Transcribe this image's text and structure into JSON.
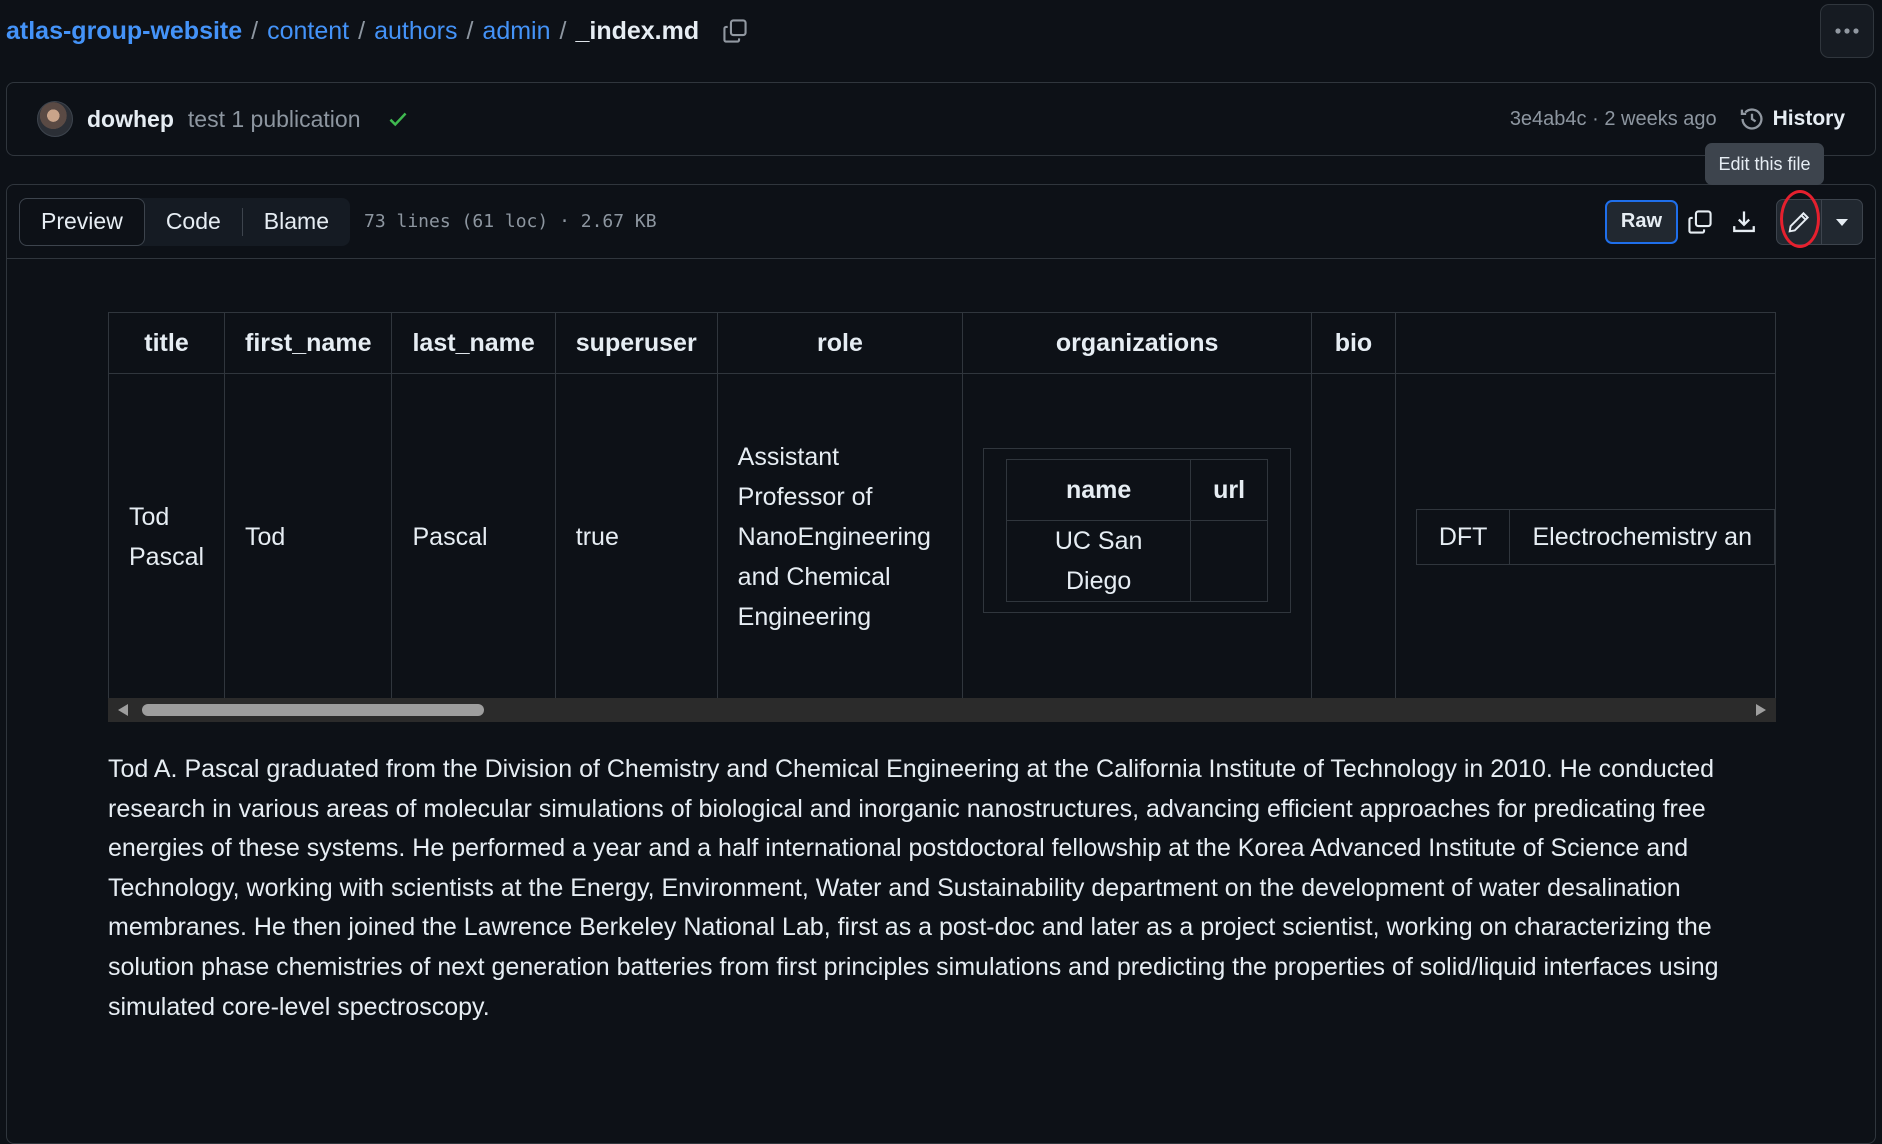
{
  "breadcrumb": {
    "repo": "atlas-group-website",
    "parts": [
      "content",
      "authors",
      "admin"
    ],
    "file": "_index.md",
    "separator": "/"
  },
  "commit": {
    "author": "dowhep",
    "message": "test 1 publication",
    "hash": "3e4ab4c",
    "time": "2 weeks ago",
    "meta_separator": " · ",
    "history_label": "History"
  },
  "file_header": {
    "tabs": [
      "Preview",
      "Code",
      "Blame"
    ],
    "active_tab": "Preview",
    "info": "73 lines (61 loc) · 2.67 KB",
    "raw_label": "Raw",
    "tooltip": "Edit this file"
  },
  "table": {
    "headers": [
      "title",
      "first_name",
      "last_name",
      "superuser",
      "role",
      "organizations",
      "bio"
    ],
    "row": {
      "title": "Tod Pascal",
      "first_name": "Tod",
      "last_name": "Pascal",
      "superuser": "true",
      "role": "Assistant Professor of NanoEngineering and Chemical Engineering",
      "organizations": {
        "headers": [
          "name",
          "url"
        ],
        "rows": [
          [
            "UC San Diego",
            ""
          ]
        ]
      },
      "bio": "",
      "interests": [
        "DFT",
        "Electrochemistry an"
      ]
    }
  },
  "bio_text": "Tod A. Pascal graduated from the Division of Chemistry and Chemical Engineering at the California Institute of Technology in 2010. He conducted research in various areas of molecular simulations of biological and inorganic nanostructures, advancing efficient approaches for predicating free energies of these systems. He performed a year and a half international postdoctoral fellowship at the Korea Advanced Institute of Science and Technology, working with scientists at the Energy, Environment, Water and Sustainability department on the development of water desalination membranes. He then joined the Lawrence Berkeley National Lab, first as a post-doc and later as a project scientist, working on characterizing the solution phase chemistries of next generation batteries from first principles simulations and predicting the properties of solid/liquid interfaces using simulated core-level spectroscopy.",
  "colors": {
    "background": "#0d1117",
    "link": "#4493f8",
    "border": "#30363d",
    "success": "#3fb950",
    "annotation": "#e5202e"
  },
  "icons": [
    "copy-icon",
    "kebab-icon",
    "check-icon",
    "history-icon",
    "copy-icon",
    "download-icon",
    "pencil-icon",
    "triangle-down-icon"
  ]
}
